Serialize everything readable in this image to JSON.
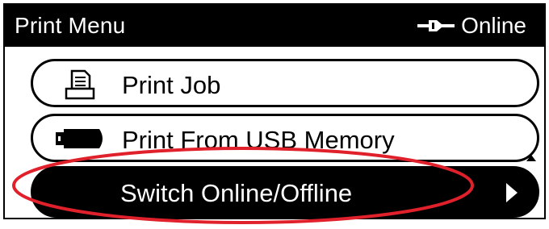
{
  "title_bar": {
    "title": "Print Menu",
    "status_icon": "plug-icon",
    "status_text": "Online"
  },
  "menu": {
    "items": [
      {
        "label": "Print Job",
        "icon": "printer-icon",
        "selected": false
      },
      {
        "label": "Print From USB Memory",
        "icon": "usb-drive-icon",
        "selected": false
      },
      {
        "label": "Switch Online/Offline",
        "icon": "arrow-right-icon",
        "selected": true
      }
    ]
  },
  "colors": {
    "background": "#ffffff",
    "bar": "#000000",
    "text": "#000000",
    "selected_text": "#ffffff",
    "annotation": "#e0202a"
  }
}
